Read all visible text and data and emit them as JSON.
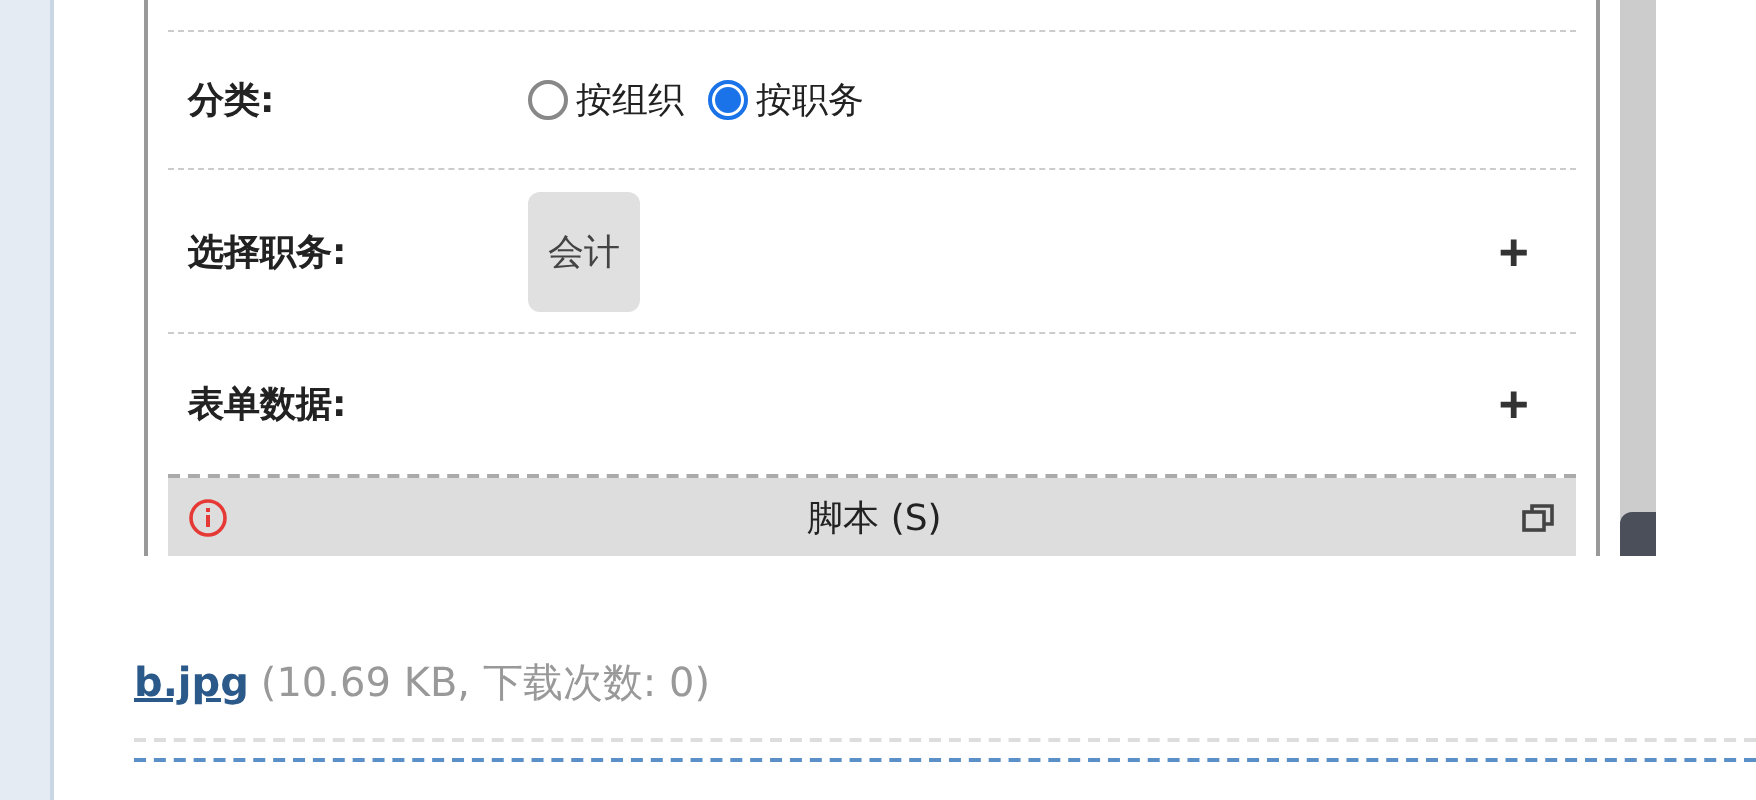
{
  "form": {
    "rows": [
      {
        "kind": "radio",
        "label": "分类:",
        "options": [
          {
            "label": "按组织",
            "selected": false
          },
          {
            "label": "按职务",
            "selected": true
          }
        ]
      },
      {
        "kind": "tags",
        "label": "选择职务:",
        "tags": [
          "会计"
        ],
        "add": "+"
      },
      {
        "kind": "tags",
        "label": "表单数据:",
        "tags": [],
        "add": "+"
      }
    ],
    "footer": {
      "title": "脚本 (S)"
    }
  },
  "attachment": {
    "name": "b.jpg",
    "meta": "(10.69 KB, 下载次数: 0)"
  }
}
